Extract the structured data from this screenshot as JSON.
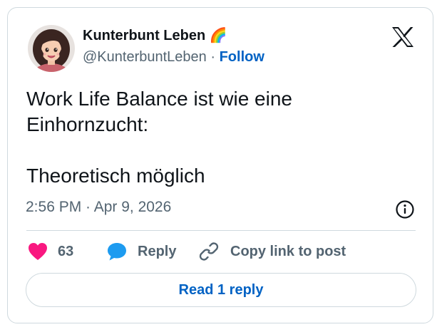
{
  "author": {
    "display_name": "Kunterbunt Leben 🌈",
    "handle": "@KunterbuntLeben",
    "separator": "·",
    "follow_label": "Follow"
  },
  "tweet": {
    "lines": [
      "Work Life Balance ist wie eine",
      "Einhornzucht:",
      "",
      "Theoretisch möglich"
    ],
    "timestamp": "2:56 PM · Apr 9, 2026"
  },
  "actions": {
    "like_count": "63",
    "reply_label": "Reply",
    "copy_link_label": "Copy link to post"
  },
  "read_reply_label": "Read 1 reply",
  "icons": {
    "logo": "x-logo-icon",
    "info": "info-icon",
    "like": "heart-icon",
    "reply": "speech-bubble-icon",
    "copy": "link-icon"
  },
  "colors": {
    "link_blue": "#0062c4",
    "like_pink": "#f91880",
    "reply_blue": "#1d9bf0",
    "text": "#0f1419",
    "secondary": "#536471",
    "border": "#cfd9de"
  }
}
